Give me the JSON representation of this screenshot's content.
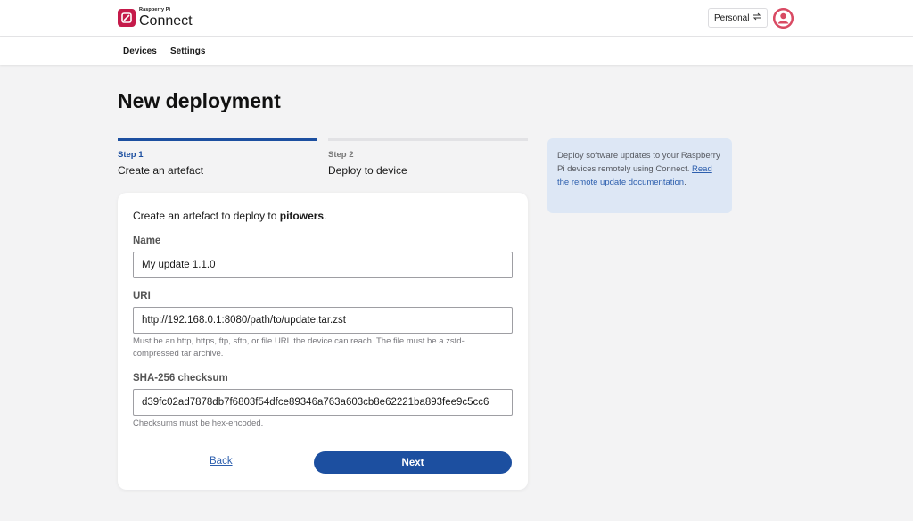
{
  "header": {
    "logo_small": "Raspberry Pi",
    "logo_big": "Connect",
    "workspace_label": "Personal",
    "brand_color": "#c51a4a"
  },
  "nav": {
    "devices": "Devices",
    "settings": "Settings"
  },
  "page": {
    "title": "New deployment"
  },
  "steps": [
    {
      "number": "Step 1",
      "label": "Create an artefact",
      "active": true
    },
    {
      "number": "Step 2",
      "label": "Deploy to device",
      "active": false
    }
  ],
  "form": {
    "intro_prefix": "Create an artefact to deploy to ",
    "intro_target": "pitowers",
    "intro_suffix": ".",
    "name_label": "Name",
    "name_value": "My update 1.1.0",
    "uri_label": "URI",
    "uri_value": "http://192.168.0.1:8080/path/to/update.tar.zst",
    "uri_help": "Must be an http, https, ftp, sftp, or file URL the device can reach. The file must be a zstd-compressed tar archive.",
    "checksum_label": "SHA-256 checksum",
    "checksum_value": "d39fc02ad7878db7f6803f54dfce89346a763a603cb8e62221ba893fee9c5cc6",
    "checksum_help": "Checksums must be hex-encoded.",
    "back_label": "Back",
    "next_label": "Next",
    "primary_color": "#1c4fa0"
  },
  "info": {
    "text": "Deploy software updates to your Raspberry Pi devices remotely using Connect. ",
    "link_text": "Read the remote update documentation",
    "suffix": "."
  }
}
